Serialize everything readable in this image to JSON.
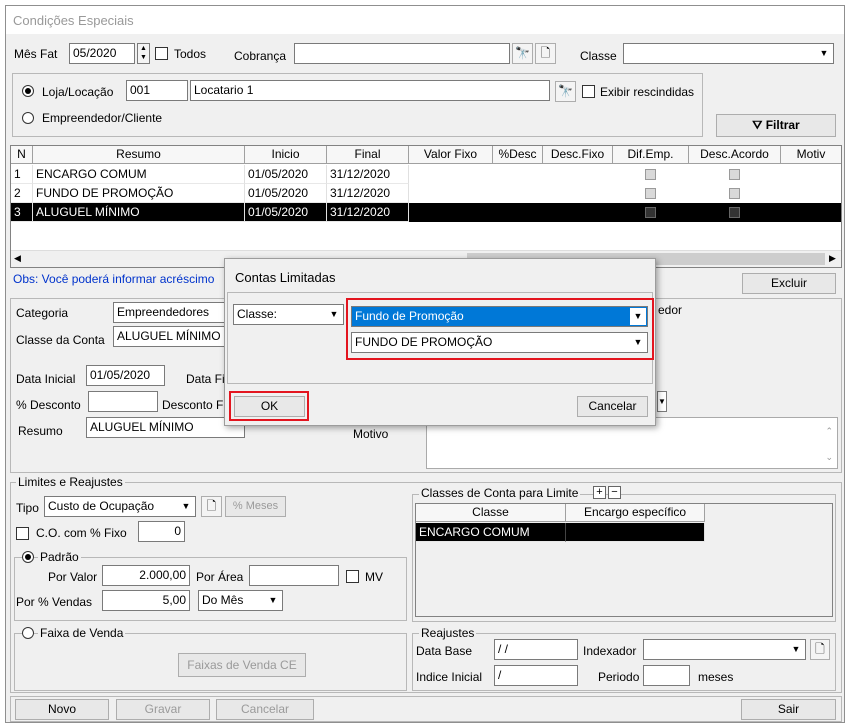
{
  "window": {
    "title": "Condições Especiais"
  },
  "top": {
    "mes_fat_label": "Mês Fat",
    "mes_fat_value": "05/2020",
    "todos_label": "Todos",
    "cobranca_label": "Cobrança",
    "cobranca_value": "",
    "classe_label": "Classe",
    "classe_value": ""
  },
  "loja": {
    "radio_label": "Loja/Locação",
    "code": "001",
    "name": "Locatario 1",
    "exibir_label": "Exibir rescindidas",
    "empreendedor_label": "Empreendedor/Cliente",
    "filtrar_label": "Filtrar"
  },
  "grid": {
    "columns": [
      "N",
      "Resumo",
      "Inicio",
      "Final",
      "Valor Fixo",
      "%Desc",
      "Desc.Fixo",
      "Dif.Emp.",
      "Desc.Acordo",
      "Motiv"
    ],
    "rows": [
      {
        "n": "1",
        "resumo": "ENCARGO COMUM",
        "inicio": "01/05/2020",
        "final": "31/12/2020"
      },
      {
        "n": "2",
        "resumo": "FUNDO DE PROMOÇÃO",
        "inicio": "01/05/2020",
        "final": "31/12/2020"
      },
      {
        "n": "3",
        "resumo": "ALUGUEL MÍNIMO",
        "inicio": "01/05/2020",
        "final": "31/12/2020"
      }
    ]
  },
  "obs_text": "Obs: Você poderá informar acréscimo",
  "excluir_label": "Excluir",
  "detail": {
    "categoria_label": "Categoria",
    "categoria_value": "Empreendedores",
    "classe_conta_label": "Classe da Conta",
    "classe_conta_value": "ALUGUEL MÍNIMO",
    "data_inicial_label": "Data Inicial",
    "data_inicial_value": "01/05/2020",
    "data_final_label": "Data Fi",
    "desconto_label": "% Desconto",
    "desconto_value": "",
    "desconto_f_label": "Desconto F",
    "resumo_label": "Resumo",
    "resumo_value": "ALUGUEL MÍNIMO",
    "motivo_label": "Motivo",
    "edor_label": "edor"
  },
  "limites": {
    "title": "Limites e Reajustes",
    "tipo_label": "Tipo",
    "tipo_value": "Custo de Ocupação",
    "meses_label": "% Meses",
    "co_label": "C.O. com % Fixo",
    "co_value": "0",
    "padrao_label": "Padrão",
    "por_valor_label": "Por Valor",
    "por_valor_value": "2.000,00",
    "por_area_label": "Por Área",
    "por_area_value": "",
    "mv_label": "MV",
    "por_vendas_label": "Por % Vendas",
    "por_vendas_value": "5,00",
    "periodo_value": "Do Mês",
    "faixa_label": "Faixa de Venda",
    "faixas_btn": "Faixas de Venda CE"
  },
  "classes_limite": {
    "title": "Classes de Conta para Limite",
    "col_classe": "Classe",
    "col_encargo": "Encargo específico",
    "row_classe": "ENCARGO COMUM",
    "row_encargo": ""
  },
  "reajustes": {
    "title": "Reajustes",
    "data_base_label": "Data Base",
    "data_base_value": "/ /",
    "indexador_label": "Indexador",
    "indexador_value": "",
    "indice_label": "Indice Inicial",
    "indice_value": "/",
    "periodo_label": "Periodo",
    "periodo_value": "",
    "meses_label": "meses"
  },
  "bottom": {
    "novo": "Novo",
    "gravar": "Gravar",
    "cancelar": "Cancelar",
    "sair": "Sair"
  },
  "dialog": {
    "title": "Contas Limitadas",
    "combo_left": "Classe:",
    "combo_right_1": "Fundo de Promoção",
    "combo_right_2": "FUNDO DE PROMOÇÃO",
    "ok": "OK",
    "cancel": "Cancelar"
  },
  "colors": {
    "selection_blue": "#0078d7",
    "highlight_red": "#e3151f",
    "obs_blue": "#0033cc"
  }
}
